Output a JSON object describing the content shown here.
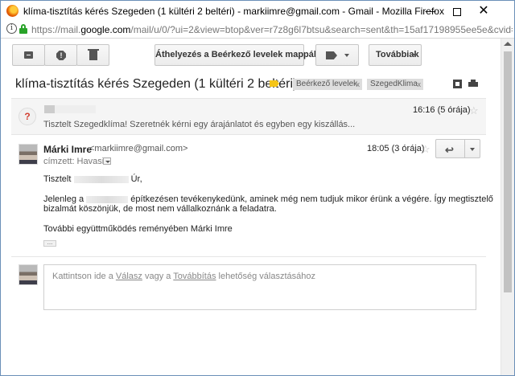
{
  "window": {
    "title": "klíma-tisztítás kérés Szegeden (1 kültéri 2 beltéri) - markiimre@gmail.com - Gmail - Mozilla Firefox",
    "minimize": "—",
    "close": "✕"
  },
  "urlbar": {
    "prefix": "https://mail.",
    "domain": "google.com",
    "suffix": "/mail/u/0/?ui=2&view=btop&ver=r7z8g6l7btsu&search=sent&th=15af17198955ee5e&cvid=1"
  },
  "toolbar": {
    "move_inbox_label": "Áthelyezés a Beérkező levelek mappába",
    "more_label": "Továbbiak"
  },
  "thread": {
    "subject": "klíma-tisztítás kérés Szegeden (1 kültéri 2 beltéri)",
    "labels": [
      {
        "name": "Beérkező levelek",
        "x": "x"
      },
      {
        "name": "SzegedKlima",
        "x": "x"
      }
    ]
  },
  "collapsed_message": {
    "avatar_glyph": "?",
    "snippet": "Tisztelt Szegedklíma! Szeretnék kérni egy árajánlatot és egyben egy kiszállás...",
    "time": "16:16 (5 órája)"
  },
  "message": {
    "sender_name": "Márki Imre",
    "sender_email": "<markiimre@gmail.com>",
    "to_label": "címzett: Havasi",
    "time": "18:05 (3 órája)",
    "reply_glyph": "↩",
    "greeting_start": "Tisztelt",
    "greeting_end": "Úr,",
    "para1_start": "Jelenleg a",
    "para1_rest": "építkezésen tevékenykedünk, aminek még nem tudjuk mikor érünk a végére. Így megtisztelő",
    "para1_line2": "bizalmát köszönjük, de most nem vállalkoznánk a feladatra.",
    "closing": "További együttműködés reményében Márki Imre",
    "ellipsis": "..."
  },
  "reply_box": {
    "text_before": "Kattintson ide a",
    "reply_link": "Válasz",
    "text_middle": "vagy a",
    "forward_link": "Továbbítás",
    "text_after": "lehetőség választásához"
  }
}
